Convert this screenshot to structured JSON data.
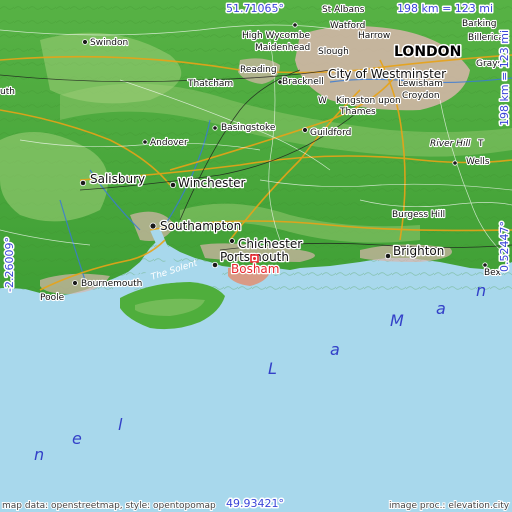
{
  "map": {
    "north_lat": "51.71065°",
    "south_lat": "49.93421°",
    "west_lon": "-2.26009°",
    "east_lon": "0.52447°",
    "scale_top": "198 km = 123 mi",
    "scale_right": "198 km = 123 mi",
    "attribution_left": "map data: openstreetmap, style: opentopomap",
    "attribution_right": "image proc.: elevation.city",
    "marker_label": "Bosham",
    "sea_name": [
      "n",
      "e",
      "l",
      "L",
      "a",
      "M",
      "a",
      "n"
    ],
    "solent_label": "The Solent",
    "places": {
      "st_albans": "St Albans",
      "swindon": "Swindon",
      "watford": "Watford",
      "harrow": "Harrow",
      "barking": "Barking",
      "billericay": "Billerica",
      "high_wycombe": "High Wycombe",
      "maidenhead": "Maidenhead",
      "slough": "Slough",
      "london": "LONDON",
      "reading": "Reading",
      "bracknell": "Bracknell",
      "city_westminster": "City of Westminster",
      "grays": "Grays",
      "lewisham": "Lewisham",
      "croydon": "Croydon",
      "thatcham": "Thatcham",
      "kingston": "Kingston upon",
      "thames": "Thames",
      "wokingham": "W",
      "basingstoke": "Basingstoke",
      "guildford": "Guildford",
      "river_hill": "River Hill",
      "tonbridge": "T",
      "wells": "Wells",
      "andover": "Andover",
      "salisbury": "Salisbury",
      "winchester": "Winchester",
      "burgess_hill": "Burgess Hill",
      "southampton": "Southampton",
      "chichester": "Chichester",
      "portsmouth": "Portsmouth",
      "brighton": "Brighton",
      "bournemouth": "Bournemouth",
      "poole": "Poole",
      "bex": "Bex",
      "uth": "uth",
      "west_edge": "th"
    }
  },
  "colors": {
    "sea": "#a8d8ec",
    "lowland": "#4dab3a",
    "upland": "#8fc46a",
    "urban": "#d9b6ad",
    "marker": "#e8262e",
    "coord_text": "#3a45d8"
  }
}
